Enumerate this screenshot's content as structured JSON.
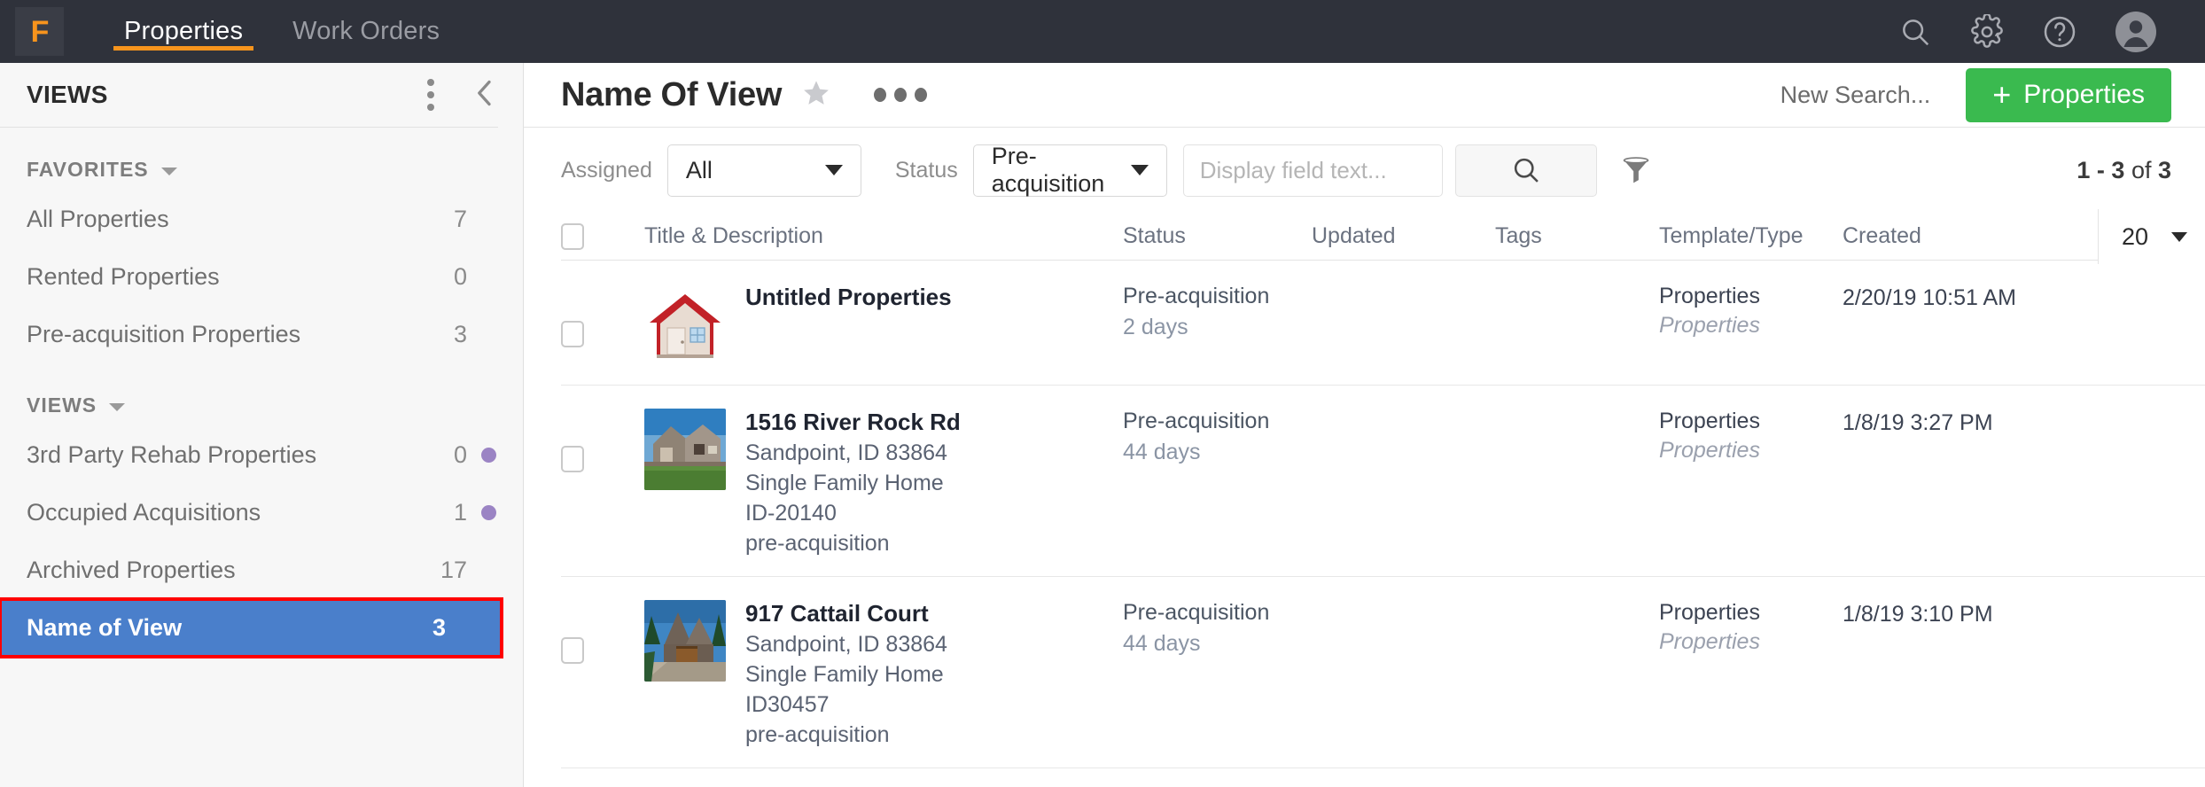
{
  "topbar": {
    "logo_glyph": "F",
    "tabs": [
      {
        "label": "Properties",
        "active": true
      },
      {
        "label": "Work Orders",
        "active": false
      }
    ],
    "icons": [
      "search-icon",
      "gear-icon",
      "help-icon",
      "avatar-icon"
    ]
  },
  "sidebar": {
    "title": "VIEWS",
    "groups": [
      {
        "heading": "FAVORITES",
        "items": [
          {
            "label": "All Properties",
            "count": "7",
            "dot": false,
            "selected": false
          },
          {
            "label": "Rented Properties",
            "count": "0",
            "dot": false,
            "selected": false
          },
          {
            "label": "Pre-acquisition Properties",
            "count": "3",
            "dot": false,
            "selected": false
          }
        ]
      },
      {
        "heading": "VIEWS",
        "items": [
          {
            "label": "3rd Party Rehab Properties",
            "count": "0",
            "dot": true,
            "selected": false
          },
          {
            "label": "Occupied Acquisitions",
            "count": "1",
            "dot": true,
            "selected": false
          },
          {
            "label": "Archived Properties",
            "count": "17",
            "dot": false,
            "selected": false
          },
          {
            "label": "Name of View",
            "count": "3",
            "dot": false,
            "selected": true
          }
        ]
      }
    ],
    "dot_color": "#9b84c4",
    "selected_bg": "#4a7fcb",
    "highlight_outline": "#ff0000"
  },
  "main": {
    "view_title": "Name Of View",
    "new_search_label": "New Search...",
    "add_button_label": "Properties",
    "add_button_plus": "+",
    "add_button_color": "#3aba4f",
    "filters": {
      "assigned_label": "Assigned",
      "assigned_value": "All",
      "status_label": "Status",
      "status_value": "Pre-acquisition",
      "display_field_placeholder": "Display field text...",
      "display_field_value": "",
      "pager_text_prefix": "1 - 3",
      "pager_text_middle": " of ",
      "pager_text_suffix": "3"
    },
    "table": {
      "columns": [
        "Title & Description",
        "Status",
        "Updated",
        "Tags",
        "Template/Type",
        "Created"
      ],
      "per_page": "20",
      "rows": [
        {
          "thumb": "house-icon-thumbnail",
          "title": "Untitled Properties",
          "sub_lines": [],
          "status": "Pre-acquisition",
          "status_age": "2 days",
          "updated": "",
          "tags": "",
          "template": "Properties",
          "type": "Properties",
          "created": "2/20/19 10:51 AM"
        },
        {
          "thumb": "house-photo-thumbnail",
          "title": "1516 River Rock Rd",
          "sub_lines": [
            "Sandpoint, ID 83864",
            "Single Family Home",
            "ID-20140",
            "pre-acquisition"
          ],
          "status": "Pre-acquisition",
          "status_age": "44 days",
          "updated": "",
          "tags": "",
          "template": "Properties",
          "type": "Properties",
          "created": "1/8/19 3:27 PM"
        },
        {
          "thumb": "cabin-photo-thumbnail",
          "title": "917 Cattail Court",
          "sub_lines": [
            "Sandpoint, ID 83864",
            "Single Family Home",
            "ID30457",
            "pre-acquisition"
          ],
          "status": "Pre-acquisition",
          "status_age": "44 days",
          "updated": "",
          "tags": "",
          "template": "Properties",
          "type": "Properties",
          "created": "1/8/19 3:10 PM"
        }
      ]
    }
  }
}
